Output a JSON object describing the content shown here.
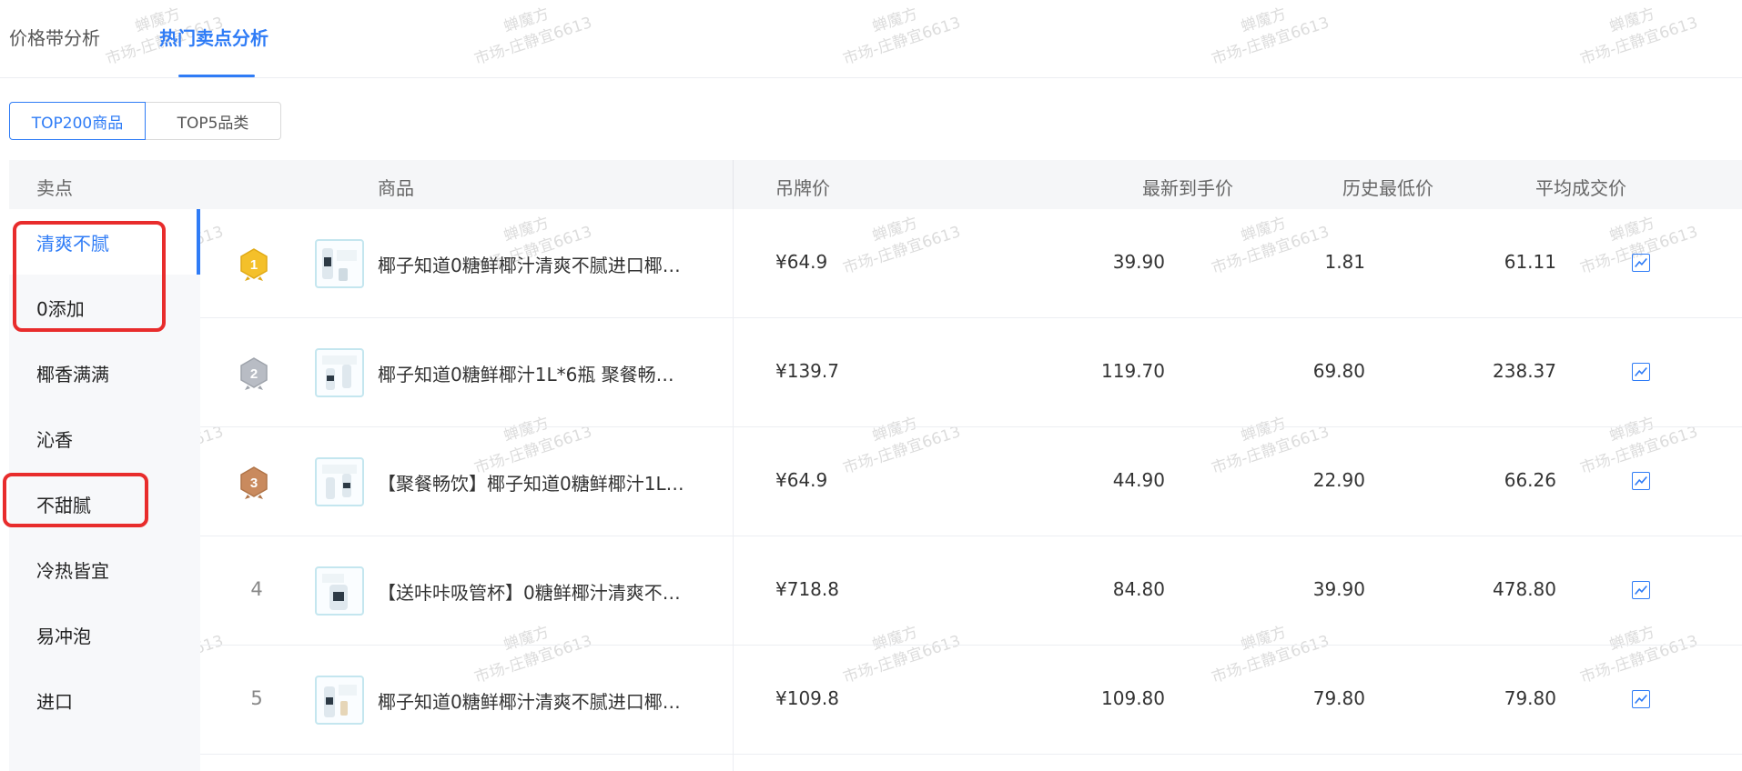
{
  "tabs": [
    {
      "label": "价格带分析",
      "active": false
    },
    {
      "label": "热门卖点分析",
      "active": true
    }
  ],
  "segments": [
    {
      "label": "TOP200商品",
      "active": true
    },
    {
      "label": "TOP5品类",
      "active": false
    }
  ],
  "table": {
    "headers": {
      "selling_point": "卖点",
      "product": "商品",
      "tag_price": "吊牌价",
      "latest_price": "最新到手价",
      "lowest_price": "历史最低价",
      "avg_price": "平均成交价"
    }
  },
  "selling_points": [
    {
      "label": "清爽不腻",
      "active": true
    },
    {
      "label": "0添加"
    },
    {
      "label": "椰香满满"
    },
    {
      "label": "沁香"
    },
    {
      "label": "不甜腻"
    },
    {
      "label": "冷热皆宜"
    },
    {
      "label": "易冲泡"
    },
    {
      "label": "进口"
    }
  ],
  "rows": [
    {
      "rank": "1",
      "medal": "gold",
      "name": "椰子知道0糖鲜椰汁清爽不腻进口椰…",
      "tag_price": "¥64.9",
      "latest_price": "39.90",
      "lowest_price": "1.81",
      "avg_price": "61.11"
    },
    {
      "rank": "2",
      "medal": "silver",
      "name": "椰子知道0糖鲜椰汁1L*6瓶 聚餐畅…",
      "tag_price": "¥139.7",
      "latest_price": "119.70",
      "lowest_price": "69.80",
      "avg_price": "238.37"
    },
    {
      "rank": "3",
      "medal": "bronze",
      "name": "【聚餐畅饮】椰子知道0糖鲜椰汁1L…",
      "tag_price": "¥64.9",
      "latest_price": "44.90",
      "lowest_price": "22.90",
      "avg_price": "66.26"
    },
    {
      "rank": "4",
      "medal": "",
      "name": "【送咔咔吸管杯】0糖鲜椰汁清爽不…",
      "tag_price": "¥718.8",
      "latest_price": "84.80",
      "lowest_price": "39.90",
      "avg_price": "478.80"
    },
    {
      "rank": "5",
      "medal": "",
      "name": "椰子知道0糖鲜椰汁清爽不腻进口椰…",
      "tag_price": "¥109.8",
      "latest_price": "109.80",
      "lowest_price": "79.80",
      "avg_price": "79.80"
    }
  ],
  "watermark": {
    "line1": "蝉魔方",
    "line2": "市场-庄静宜6613"
  },
  "colors": {
    "accent": "#2f7cf6",
    "annotation": "#e82c2c",
    "gold": "#f4c02a",
    "silver": "#b8bcc4",
    "bronze": "#c98a5e"
  }
}
